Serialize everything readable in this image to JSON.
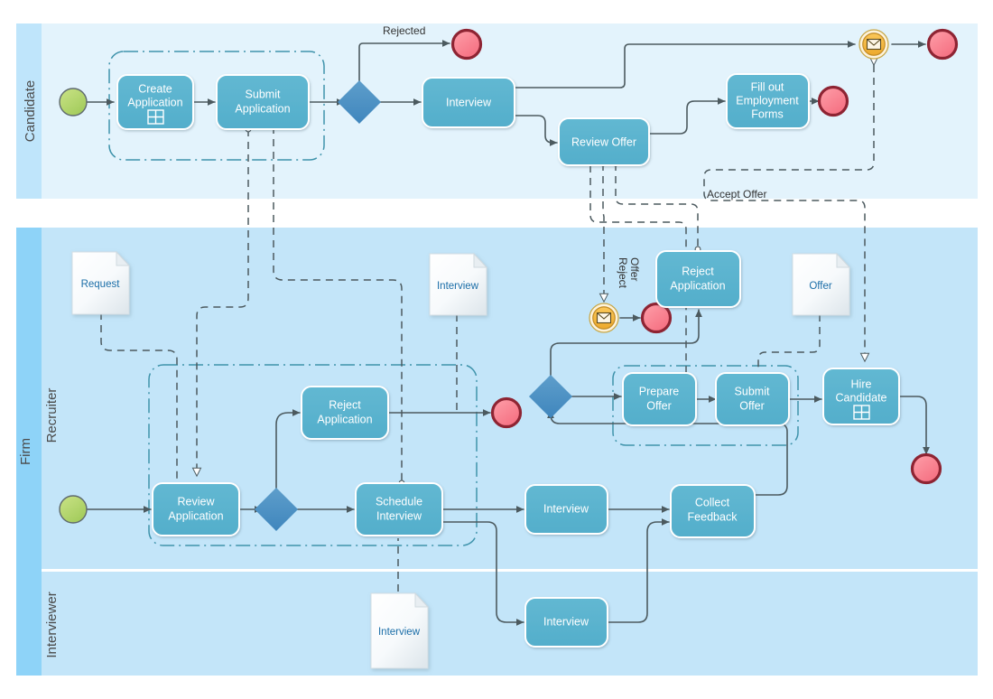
{
  "diagram": {
    "title": "Hiring Process BPMN Diagram",
    "type": "bpmn-collaboration"
  },
  "colors": {
    "pool_candidate_bg": "#e3f3fc",
    "pool_firm_bg": "#c3e5f9",
    "lane_header_candidate": "#bfe5fb",
    "lane_header_firm": "#8ed3f8",
    "task_fill": "#5cb3cf",
    "task_stroke": "#ffffff",
    "gateway_fill": "#4a90c4",
    "start_event_fill": "#b5d96a",
    "end_event_fill": "#f97f8e",
    "end_event_stroke": "#8e2433",
    "message_event_fill": "#f6b93f",
    "connector": "#4c5a5f",
    "group_border": "#3a90a8",
    "doc_label": "#1b6ea8"
  },
  "pools": [
    {
      "id": "pool-candidate",
      "label": "Candidate",
      "lanes": [
        {
          "id": "lane-candidate",
          "label": "Candidate"
        }
      ]
    },
    {
      "id": "pool-firm",
      "label": "Firm",
      "lanes": [
        {
          "id": "lane-recruiter",
          "label": "Recruiter"
        },
        {
          "id": "lane-interviewer",
          "label": "Interviewer"
        }
      ]
    }
  ],
  "tasks": [
    {
      "id": "create-application",
      "label_lines": [
        "Create",
        "Application"
      ],
      "marker": "sub-process",
      "lane": "Candidate"
    },
    {
      "id": "submit-application",
      "label_lines": [
        "Submit",
        "Application"
      ],
      "marker": "none",
      "lane": "Candidate"
    },
    {
      "id": "interview-candidate",
      "label_lines": [
        "Interview"
      ],
      "marker": "none",
      "lane": "Candidate"
    },
    {
      "id": "review-offer",
      "label_lines": [
        "Review Offer"
      ],
      "marker": "none",
      "lane": "Candidate"
    },
    {
      "id": "fill-out-employment-forms",
      "label_lines": [
        "Fill out",
        "Employment",
        "Forms"
      ],
      "marker": "none",
      "lane": "Candidate"
    },
    {
      "id": "reject-application-recruiter",
      "label_lines": [
        "Reject",
        "Application"
      ],
      "marker": "none",
      "lane": "Recruiter"
    },
    {
      "id": "review-application",
      "label_lines": [
        "Review",
        "Application"
      ],
      "marker": "none",
      "lane": "Recruiter"
    },
    {
      "id": "schedule-interview",
      "label_lines": [
        "Schedule",
        "Interview"
      ],
      "marker": "none",
      "lane": "Recruiter"
    },
    {
      "id": "interview-recruiter",
      "label_lines": [
        "Interview"
      ],
      "marker": "none",
      "lane": "Recruiter"
    },
    {
      "id": "collect-feedback",
      "label_lines": [
        "Collect",
        "Feedback"
      ],
      "marker": "none",
      "lane": "Recruiter"
    },
    {
      "id": "reject-application-offer",
      "label_lines": [
        "Reject",
        "Application"
      ],
      "marker": "none",
      "lane": "Recruiter"
    },
    {
      "id": "prepare-offer",
      "label_lines": [
        "Prepare",
        "Offer"
      ],
      "marker": "none",
      "lane": "Recruiter"
    },
    {
      "id": "submit-offer",
      "label_lines": [
        "Submit",
        "Offer"
      ],
      "marker": "none",
      "lane": "Recruiter"
    },
    {
      "id": "hire-candidate",
      "label_lines": [
        "Hire",
        "Candidate"
      ],
      "marker": "sub-process",
      "lane": "Recruiter"
    },
    {
      "id": "interview-interviewer",
      "label_lines": [
        "Interview"
      ],
      "marker": "none",
      "lane": "Interviewer"
    }
  ],
  "documents": [
    {
      "id": "doc-request",
      "label": "Request",
      "lane": "Recruiter"
    },
    {
      "id": "doc-interview-recruiter",
      "label": "Interview",
      "lane": "Recruiter"
    },
    {
      "id": "doc-offer",
      "label": "Offer",
      "lane": "Recruiter"
    },
    {
      "id": "doc-interview-interviewer",
      "label": "Interview",
      "lane": "Interviewer"
    }
  ],
  "events": [
    {
      "id": "start-candidate",
      "kind": "start",
      "lane": "Candidate"
    },
    {
      "id": "end-rejected",
      "kind": "end",
      "lane": "Candidate"
    },
    {
      "id": "message-end-candidate",
      "kind": "message-throw",
      "lane": "Candidate"
    },
    {
      "id": "end-candidate-top",
      "kind": "end",
      "lane": "Candidate"
    },
    {
      "id": "end-employment-forms",
      "kind": "end",
      "lane": "Candidate"
    },
    {
      "id": "message-reject-offer",
      "kind": "message-catch",
      "lane": "Recruiter"
    },
    {
      "id": "end-reject-offer",
      "kind": "end",
      "lane": "Recruiter"
    },
    {
      "id": "start-recruiter",
      "kind": "start",
      "lane": "Recruiter"
    },
    {
      "id": "end-reject-application",
      "kind": "end",
      "lane": "Recruiter"
    },
    {
      "id": "end-hire-candidate",
      "kind": "end",
      "lane": "Recruiter"
    }
  ],
  "gateways": [
    {
      "id": "gw-candidate-submit",
      "lane": "Candidate"
    },
    {
      "id": "gw-review-application",
      "lane": "Recruiter"
    },
    {
      "id": "gw-offer-decision",
      "lane": "Recruiter"
    }
  ],
  "flow_labels": [
    {
      "id": "label-rejected",
      "text": "Rejected"
    },
    {
      "id": "label-accept-offer",
      "text": "Accept Offer"
    },
    {
      "id": "label-reject-offer",
      "text": "Reject\nOffer",
      "line1": "Reject",
      "line2": "Offer"
    }
  ],
  "groups": [
    {
      "id": "group-candidate-application",
      "lane": "Candidate"
    },
    {
      "id": "group-recruiter-review",
      "lane": "Recruiter"
    },
    {
      "id": "group-recruiter-offer",
      "lane": "Recruiter"
    }
  ]
}
